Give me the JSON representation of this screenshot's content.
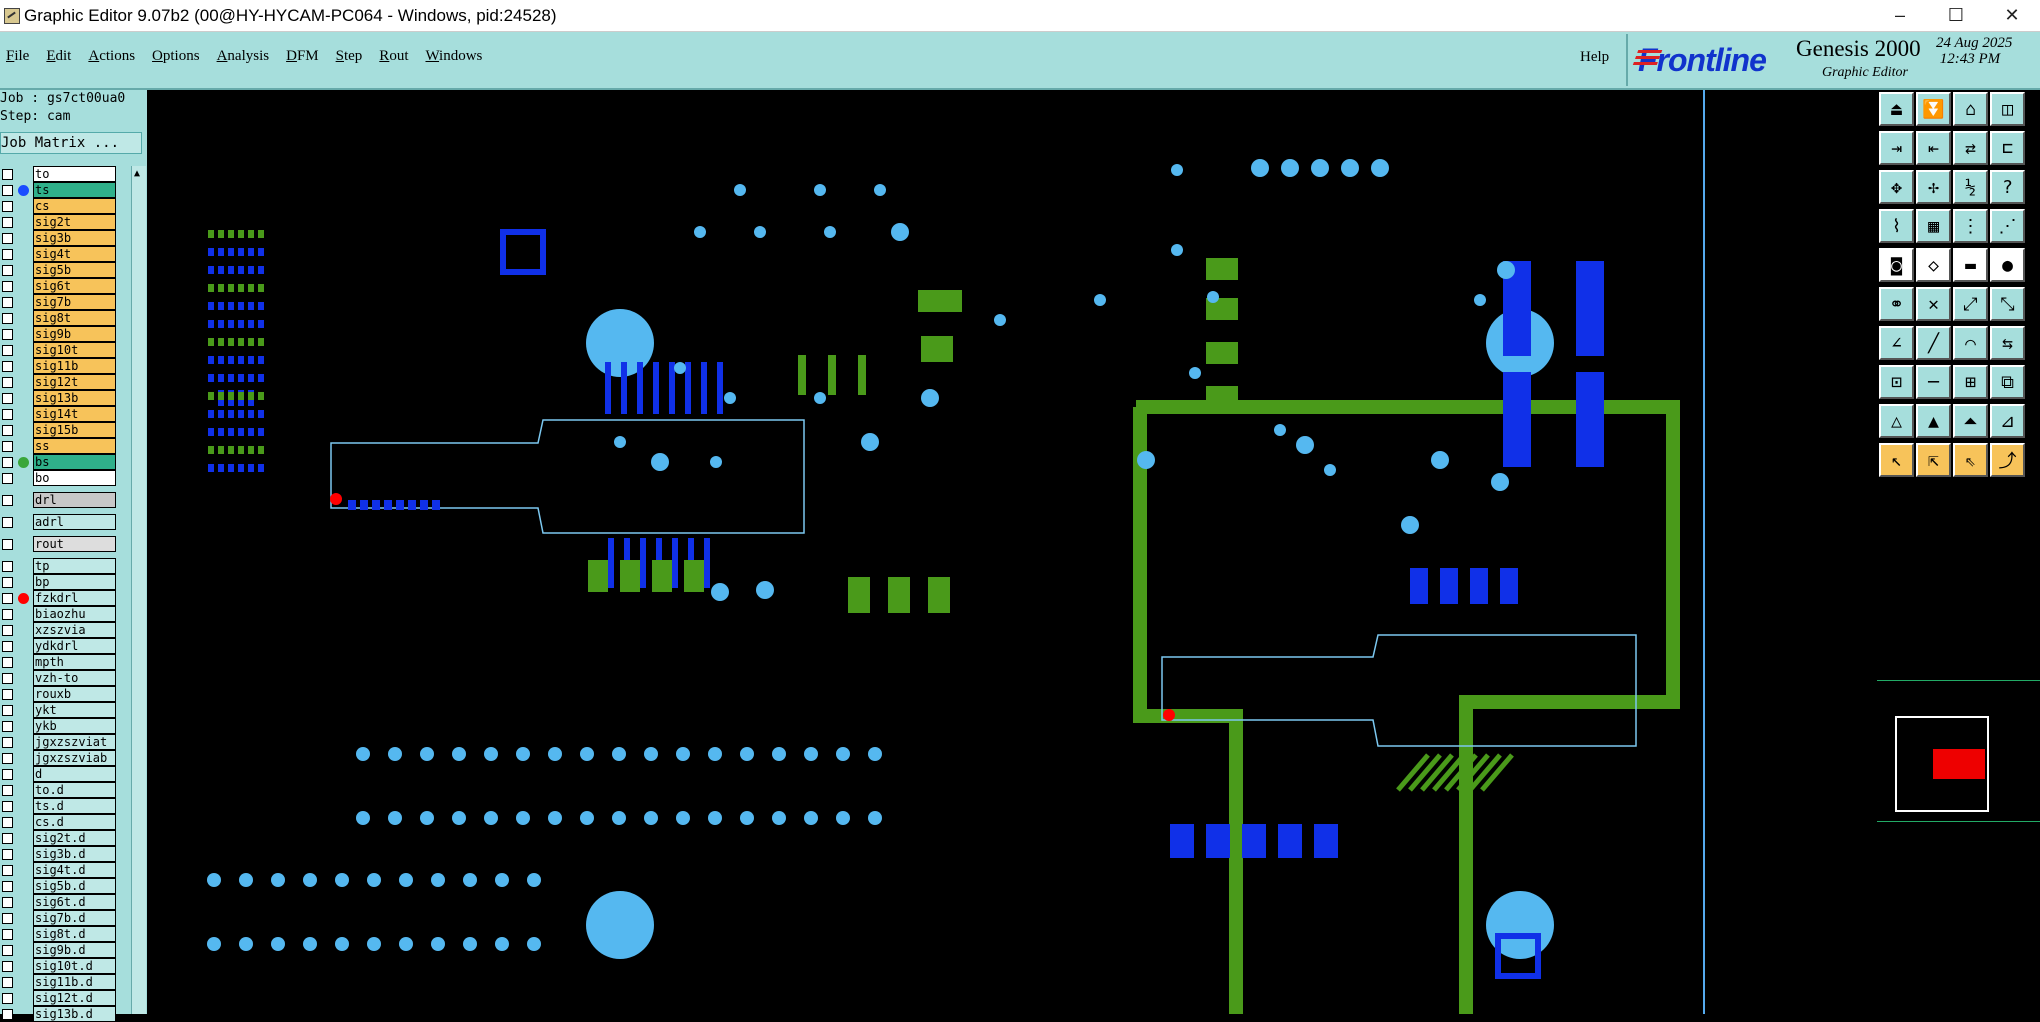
{
  "window": {
    "title": "Graphic Editor 9.07b2 (00@HY-HYCAM-PC064 - Windows, pid:24528)",
    "minimize": "–",
    "maximize": "☐",
    "close": "✕"
  },
  "menu": {
    "items": [
      "File",
      "Edit",
      "Actions",
      "Options",
      "Analysis",
      "DFM",
      "Step",
      "Rout",
      "Windows"
    ],
    "help": "Help"
  },
  "brand": {
    "logo": "Frontline",
    "product": "Genesis 2000",
    "subtitle": "Graphic Editor",
    "date": "24 Aug 2025",
    "time": "12:43 PM"
  },
  "job": {
    "job_line": "Job : gs7ct00ua0",
    "step_line": "Step: cam",
    "matrix_button": "Job Matrix ..."
  },
  "layers": [
    {
      "name": "to",
      "bg": "#ffffff",
      "dot": ""
    },
    {
      "name": "ts",
      "bg": "#2fb08a",
      "dot": "#1a4cff"
    },
    {
      "name": "cs",
      "bg": "#f7c35a",
      "dot": ""
    },
    {
      "name": "sig2t",
      "bg": "#f7c35a",
      "dot": ""
    },
    {
      "name": "sig3b",
      "bg": "#f7c35a",
      "dot": ""
    },
    {
      "name": "sig4t",
      "bg": "#f7c35a",
      "dot": ""
    },
    {
      "name": "sig5b",
      "bg": "#f7c35a",
      "dot": ""
    },
    {
      "name": "sig6t",
      "bg": "#f7c35a",
      "dot": ""
    },
    {
      "name": "sig7b",
      "bg": "#f7c35a",
      "dot": ""
    },
    {
      "name": "sig8t",
      "bg": "#f7c35a",
      "dot": ""
    },
    {
      "name": "sig9b",
      "bg": "#f7c35a",
      "dot": ""
    },
    {
      "name": "sig10t",
      "bg": "#f7c35a",
      "dot": ""
    },
    {
      "name": "sig11b",
      "bg": "#f7c35a",
      "dot": ""
    },
    {
      "name": "sig12t",
      "bg": "#f7c35a",
      "dot": ""
    },
    {
      "name": "sig13b",
      "bg": "#f7c35a",
      "dot": ""
    },
    {
      "name": "sig14t",
      "bg": "#f7c35a",
      "dot": ""
    },
    {
      "name": "sig15b",
      "bg": "#f7c35a",
      "dot": ""
    },
    {
      "name": "ss",
      "bg": "#f7c35a",
      "dot": ""
    },
    {
      "name": "bs",
      "bg": "#2fb08a",
      "dot": "#3aa63a"
    },
    {
      "name": "bo",
      "bg": "#ffffff",
      "dot": ""
    },
    {
      "sep": true
    },
    {
      "name": "drl",
      "bg": "#c8c8c8",
      "dot": ""
    },
    {
      "sep": true
    },
    {
      "name": "adrl",
      "bg": "#bfe8e6",
      "dot": ""
    },
    {
      "sep": true
    },
    {
      "name": "rout",
      "bg": "#dddddd",
      "dot": ""
    },
    {
      "sep": true
    },
    {
      "name": "tp",
      "bg": "#bfe8e6",
      "dot": ""
    },
    {
      "name": "bp",
      "bg": "#bfe8e6",
      "dot": ""
    },
    {
      "name": "fzkdrl",
      "bg": "#bfe8e6",
      "dot": "#ff0000"
    },
    {
      "name": "biaozhu",
      "bg": "#bfe8e6",
      "dot": ""
    },
    {
      "name": "xzszvia",
      "bg": "#bfe8e6",
      "dot": ""
    },
    {
      "name": "ydkdrl",
      "bg": "#bfe8e6",
      "dot": ""
    },
    {
      "name": "mpth",
      "bg": "#bfe8e6",
      "dot": ""
    },
    {
      "name": "vzh-to",
      "bg": "#bfe8e6",
      "dot": ""
    },
    {
      "name": "rouxb",
      "bg": "#bfe8e6",
      "dot": ""
    },
    {
      "name": "ykt",
      "bg": "#bfe8e6",
      "dot": ""
    },
    {
      "name": "ykb",
      "bg": "#bfe8e6",
      "dot": ""
    },
    {
      "name": "jgxzszviat",
      "bg": "#bfe8e6",
      "dot": ""
    },
    {
      "name": "jgxzszviab",
      "bg": "#bfe8e6",
      "dot": ""
    },
    {
      "name": "d",
      "bg": "#bfe8e6",
      "dot": ""
    },
    {
      "name": "to.d",
      "bg": "#bfe8e6",
      "dot": ""
    },
    {
      "name": "ts.d",
      "bg": "#bfe8e6",
      "dot": ""
    },
    {
      "name": "cs.d",
      "bg": "#bfe8e6",
      "dot": ""
    },
    {
      "name": "sig2t.d",
      "bg": "#bfe8e6",
      "dot": ""
    },
    {
      "name": "sig3b.d",
      "bg": "#bfe8e6",
      "dot": ""
    },
    {
      "name": "sig4t.d",
      "bg": "#bfe8e6",
      "dot": ""
    },
    {
      "name": "sig5b.d",
      "bg": "#bfe8e6",
      "dot": ""
    },
    {
      "name": "sig6t.d",
      "bg": "#bfe8e6",
      "dot": ""
    },
    {
      "name": "sig7b.d",
      "bg": "#bfe8e6",
      "dot": ""
    },
    {
      "name": "sig8t.d",
      "bg": "#bfe8e6",
      "dot": ""
    },
    {
      "name": "sig9b.d",
      "bg": "#bfe8e6",
      "dot": ""
    },
    {
      "name": "sig10t.d",
      "bg": "#bfe8e6",
      "dot": ""
    },
    {
      "name": "sig11b.d",
      "bg": "#bfe8e6",
      "dot": ""
    },
    {
      "name": "sig12t.d",
      "bg": "#bfe8e6",
      "dot": ""
    },
    {
      "name": "sig13b.d",
      "bg": "#bfe8e6",
      "dot": ""
    }
  ],
  "tools": [
    {
      "icon": "layer-up-icon",
      "bg": "#a6dedc",
      "g": "⏏"
    },
    {
      "icon": "layer-down-icon",
      "bg": "#a6dedc",
      "g": "⏬"
    },
    {
      "icon": "home-icon",
      "bg": "#a6dedc",
      "g": "⌂"
    },
    {
      "icon": "split-view-icon",
      "bg": "#a6dedc",
      "g": "◫"
    },
    {
      "icon": "import-icon",
      "bg": "#a6dedc",
      "g": "⇥"
    },
    {
      "icon": "export-icon",
      "bg": "#a6dedc",
      "g": "⇤"
    },
    {
      "icon": "link-icon",
      "bg": "#a6dedc",
      "g": "⇄"
    },
    {
      "icon": "snap-icon",
      "bg": "#a6dedc",
      "g": "⊏"
    },
    {
      "icon": "zoom-fit-icon",
      "bg": "#a6dedc",
      "g": "✥"
    },
    {
      "icon": "pan-icon",
      "bg": "#a6dedc",
      "g": "✢"
    },
    {
      "icon": "scale-1-2-icon",
      "bg": "#a6dedc",
      "g": "½"
    },
    {
      "icon": "help-icon",
      "bg": "#a6dedc",
      "g": "?"
    },
    {
      "icon": "measure-icon",
      "bg": "#a6dedc",
      "g": "⌇"
    },
    {
      "icon": "grid-icon",
      "bg": "#a6dedc",
      "g": "▦"
    },
    {
      "icon": "net-highlight-icon",
      "bg": "#a6dedc",
      "g": "⋮"
    },
    {
      "icon": "net-tracking-icon",
      "bg": "#a6dedc",
      "g": "⋰"
    },
    {
      "icon": "add-pad-icon",
      "bg": "#ffffff",
      "g": "◙"
    },
    {
      "icon": "add-shape-icon",
      "bg": "#ffffff",
      "g": "◇"
    },
    {
      "icon": "add-line-icon",
      "bg": "#ffffff",
      "g": "▬"
    },
    {
      "icon": "add-circle-icon",
      "bg": "#ffffff",
      "g": "●"
    },
    {
      "icon": "connect-icon",
      "bg": "#a6dedc",
      "g": "⚭"
    },
    {
      "icon": "intersect-icon",
      "bg": "#a6dedc",
      "g": "✕"
    },
    {
      "icon": "move-point-icon",
      "bg": "#a6dedc",
      "g": "⤢"
    },
    {
      "icon": "stretch-icon",
      "bg": "#a6dedc",
      "g": "⤡"
    },
    {
      "icon": "angle-icon",
      "bg": "#a6dedc",
      "g": "∠"
    },
    {
      "icon": "slope-icon",
      "bg": "#a6dedc",
      "g": "╱"
    },
    {
      "icon": "arc-icon",
      "bg": "#a6dedc",
      "g": "⌒"
    },
    {
      "icon": "flip-icon",
      "bg": "#a6dedc",
      "g": "⇆"
    },
    {
      "icon": "feature-select-icon",
      "bg": "#a6dedc",
      "g": "⊡"
    },
    {
      "icon": "line-edit-icon",
      "bg": "#a6dedc",
      "g": "─"
    },
    {
      "icon": "resize-icon",
      "bg": "#a6dedc",
      "g": "⊞"
    },
    {
      "icon": "group-icon",
      "bg": "#a6dedc",
      "g": "⧉"
    },
    {
      "icon": "triangle-icon",
      "bg": "#a6dedc",
      "g": "△"
    },
    {
      "icon": "triangle-a-icon",
      "bg": "#a6dedc",
      "g": "▲"
    },
    {
      "icon": "triangle-b-icon",
      "bg": "#a6dedc",
      "g": "⏶"
    },
    {
      "icon": "triangle-c-icon",
      "bg": "#a6dedc",
      "g": "⊿"
    },
    {
      "icon": "select-pointer-icon",
      "bg": "#f7c35a",
      "g": "↖"
    },
    {
      "icon": "select-area-icon",
      "bg": "#f7c35a",
      "g": "⇱"
    },
    {
      "icon": "select-outline-icon",
      "bg": "#f7c35a",
      "g": "⇖"
    },
    {
      "icon": "select-net-icon",
      "bg": "#f7c35a",
      "g": "⤴"
    }
  ]
}
